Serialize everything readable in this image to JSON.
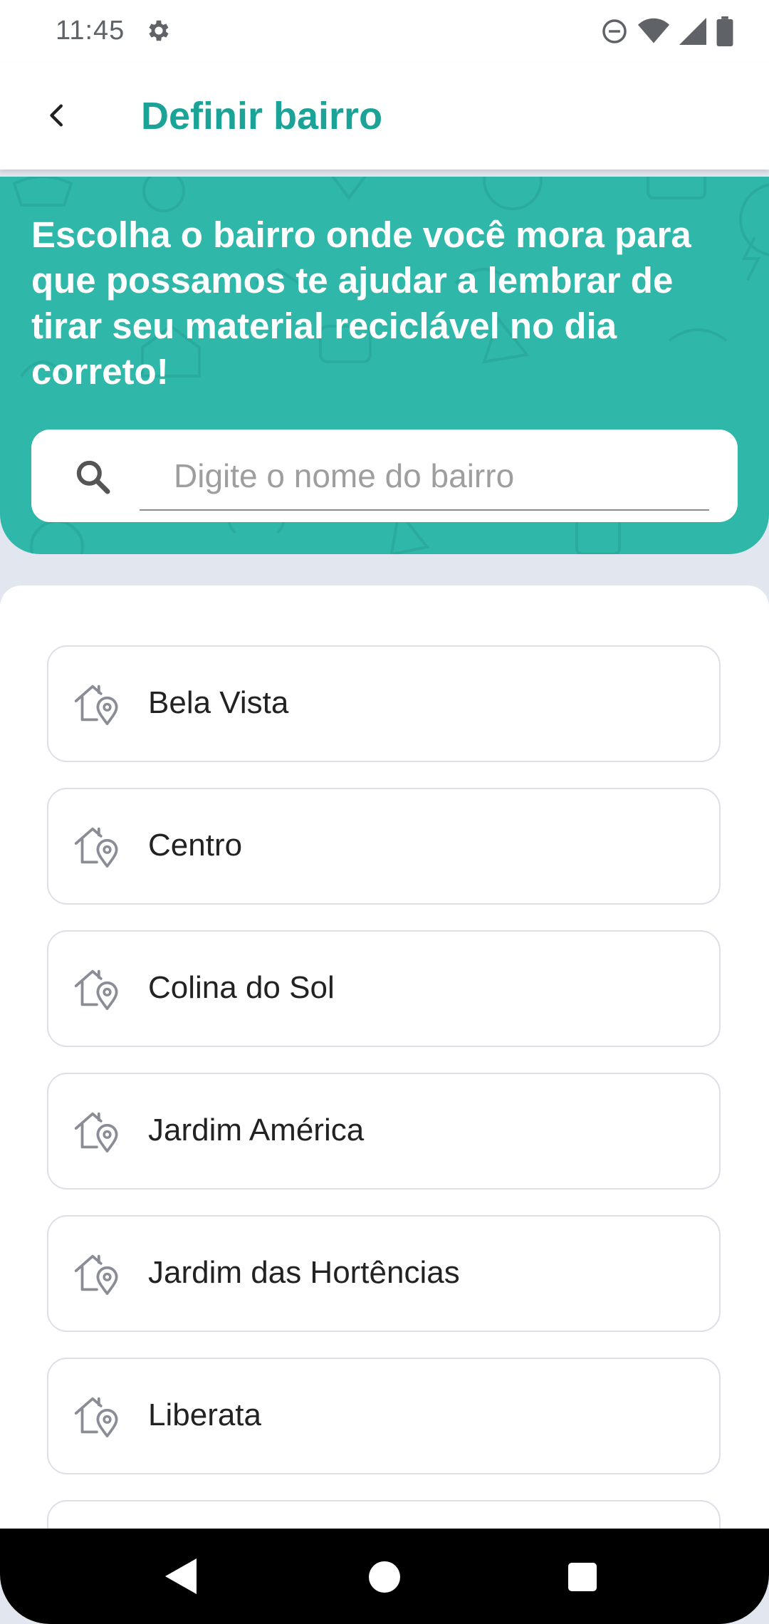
{
  "status_bar": {
    "time": "11:45",
    "icons": [
      "gear-icon",
      "dnd-icon",
      "wifi-icon",
      "signal-icon",
      "battery-icon"
    ]
  },
  "app_bar": {
    "title": "Definir bairro",
    "back_icon": "chevron-left-icon"
  },
  "banner": {
    "message": "Escolha o bairro onde você mora para que possamos te ajudar a lembrar de tirar seu material reciclável no dia correto!",
    "search": {
      "placeholder": "Digite o nome do bairro",
      "value": ""
    }
  },
  "neighborhoods": [
    {
      "label": "Bela Vista"
    },
    {
      "label": "Centro"
    },
    {
      "label": "Colina do Sol"
    },
    {
      "label": "Jardim América"
    },
    {
      "label": "Jardim das Hortências"
    },
    {
      "label": "Liberata"
    }
  ],
  "colors": {
    "accent": "#1AA396",
    "banner": "#2FB7A9",
    "background": "#E2E6EE",
    "card_border": "#DCDFE8"
  }
}
